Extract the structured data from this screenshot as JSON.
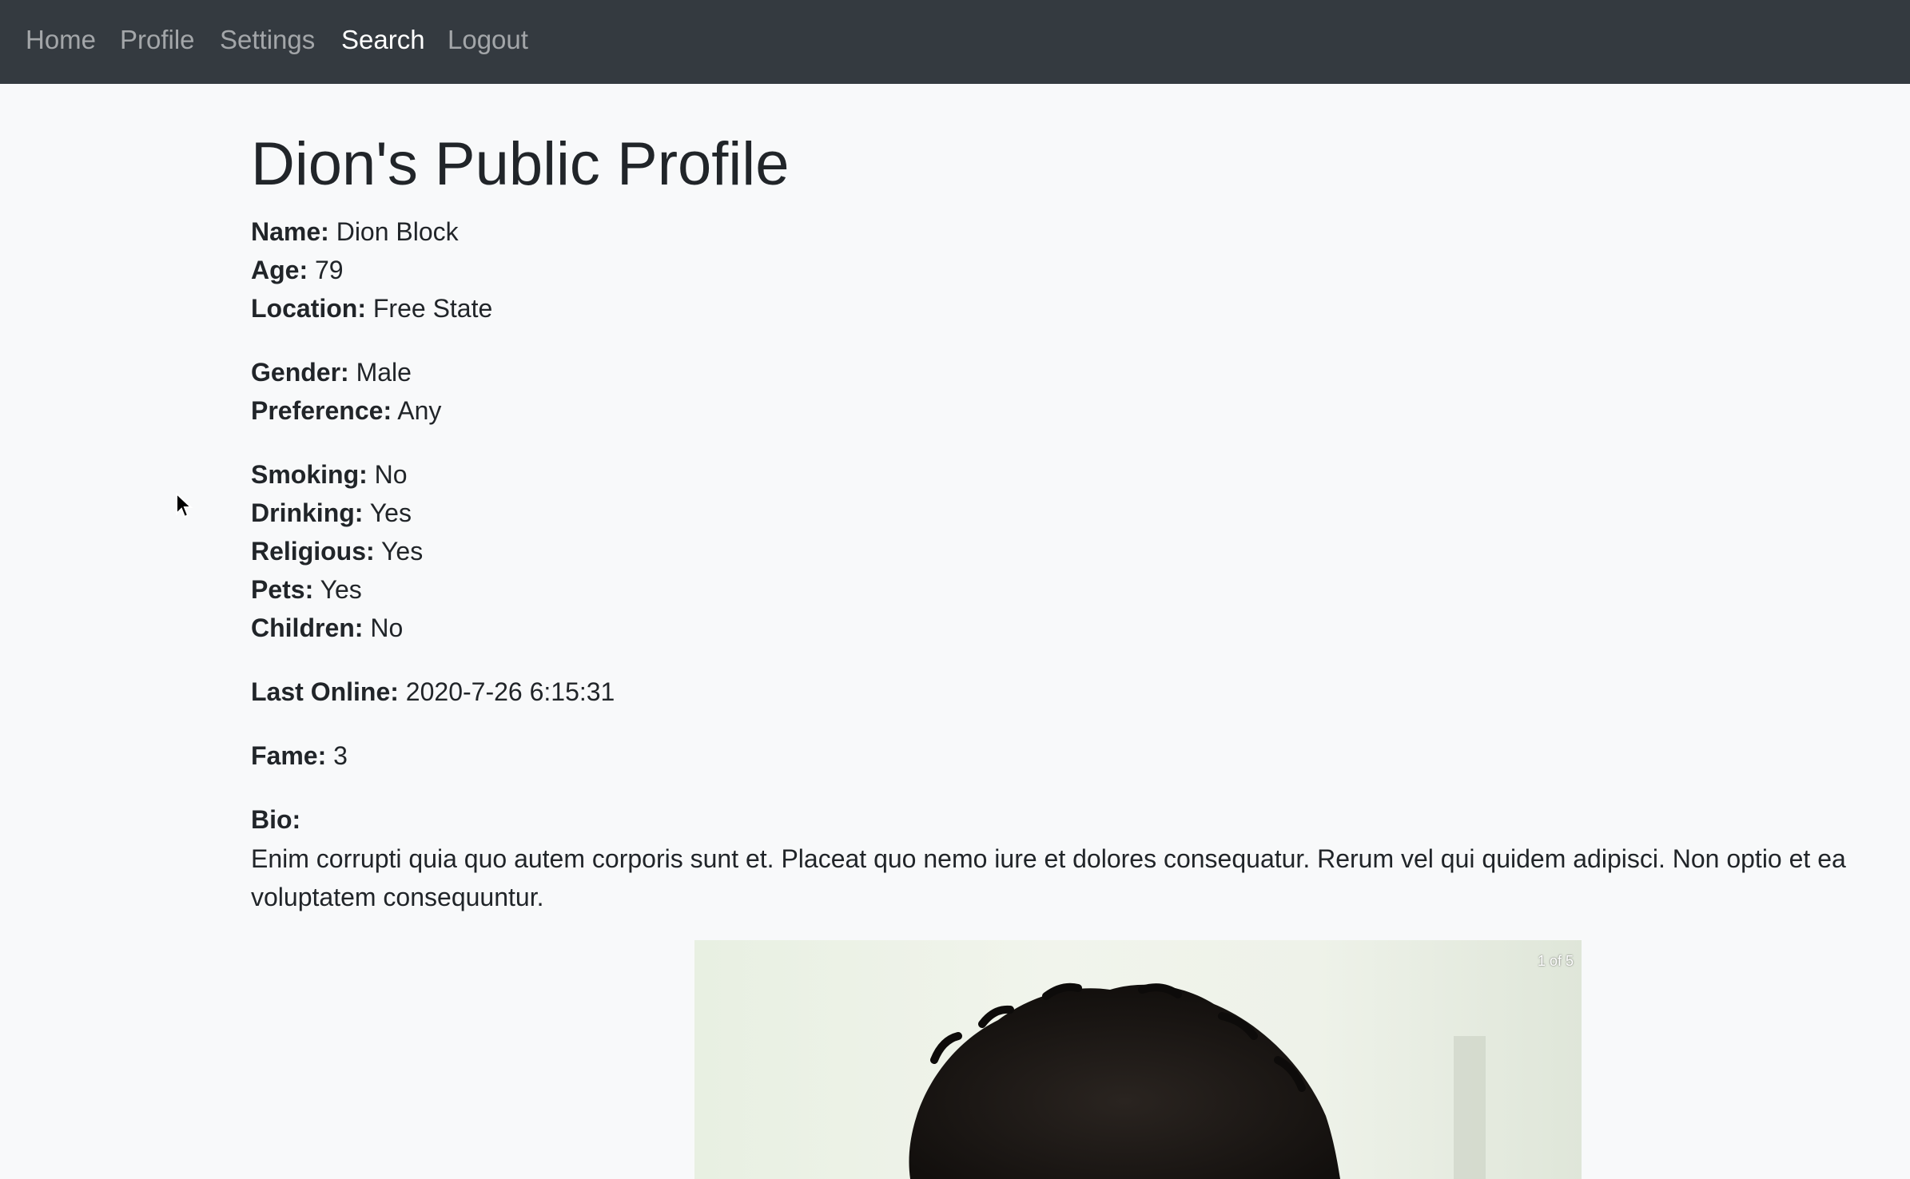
{
  "nav": {
    "items": [
      {
        "label": "Home"
      },
      {
        "label": "Profile"
      },
      {
        "label": "Settings"
      },
      {
        "label": "Search",
        "active": true
      },
      {
        "label": "Logout"
      }
    ]
  },
  "profile": {
    "title": "Dion's Public Profile",
    "name": {
      "label": "Name:",
      "value": "Dion Block"
    },
    "age": {
      "label": "Age:",
      "value": "79"
    },
    "location": {
      "label": "Location:",
      "value": "Free State"
    },
    "gender": {
      "label": "Gender:",
      "value": "Male"
    },
    "preference": {
      "label": "Preference:",
      "value": "Any"
    },
    "smoking": {
      "label": "Smoking:",
      "value": "No"
    },
    "drinking": {
      "label": "Drinking:",
      "value": "Yes"
    },
    "religious": {
      "label": "Religious:",
      "value": "Yes"
    },
    "pets": {
      "label": "Pets:",
      "value": "Yes"
    },
    "children": {
      "label": "Children:",
      "value": "No"
    },
    "last_online": {
      "label": "Last Online:",
      "value": "2020-7-26 6:15:31"
    },
    "fame": {
      "label": "Fame:",
      "value": "3"
    },
    "bio": {
      "label": "Bio:",
      "text": "Enim corrupti quia quo autem corporis sunt et. Placeat quo nemo iure et dolores consequatur. Rerum vel qui quidem adipisci. Non optio et ea voluptatem consequuntur."
    }
  },
  "carousel": {
    "counter": "1 of 5"
  },
  "colors": {
    "navbar_bg": "#343a40",
    "page_bg": "#f8f9fa",
    "text": "#212529"
  }
}
